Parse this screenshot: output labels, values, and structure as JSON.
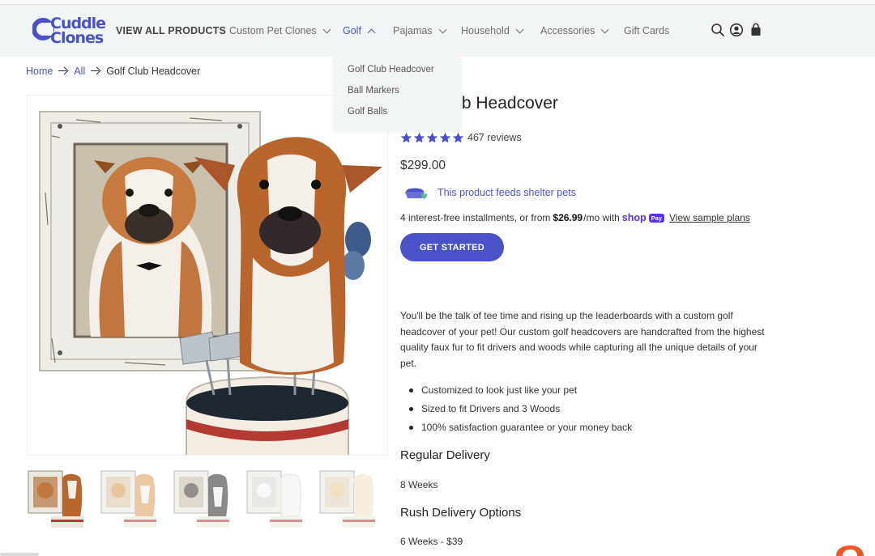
{
  "brand": {
    "logo_line1": "Cuddle",
    "logo_line2": "Clones",
    "accent": "#4b52c7"
  },
  "nav": {
    "items": [
      {
        "label": "VIEW ALL PRODUCTS",
        "dropdown": false
      },
      {
        "label": "Custom Pet Clones",
        "dropdown": true
      },
      {
        "label": "Golf",
        "dropdown": true,
        "expanded": true
      },
      {
        "label": "Pajamas",
        "dropdown": true
      },
      {
        "label": "Household",
        "dropdown": true
      },
      {
        "label": "Accessories",
        "dropdown": true
      },
      {
        "label": "Gift Cards",
        "dropdown": false
      }
    ],
    "icons": [
      "search-icon",
      "account-icon",
      "cart-bag-icon"
    ]
  },
  "golf_menu": {
    "items": [
      "Golf Club Headcover",
      "Ball Markers",
      "Golf Balls"
    ]
  },
  "breadcrumb": {
    "home": "Home",
    "all": "All",
    "current": "Golf Club Headcover"
  },
  "product": {
    "title": "Golf Club Headcover",
    "rating": 5,
    "reviews": "467 reviews",
    "price": "$299.00",
    "shelter_text": "This product feeds shelter pets",
    "installments": {
      "prefix": "4 interest-free installments, or from",
      "amount": "$26.99",
      "suffix": "/mo with",
      "shop": "shop",
      "pay": "Pay",
      "link": "View sample plans"
    },
    "cta": "GET STARTED",
    "description": "You'll be the talk of tee time and rising up the leaderboards with a custom golf headcover of your pet! Our custom golf headcovers are handcrafted from the highest quality faux fur to fit drivers and woods while capturing all the unique details of your pet.",
    "bullets": [
      "Customized to look just like your pet",
      "Sized to fit Drivers and 3 Woods",
      "100% satisfaction guarantee or your money back"
    ],
    "regular_delivery": {
      "heading": "Regular Delivery",
      "value": "8 Weeks"
    },
    "rush_delivery": {
      "heading": "Rush Delivery Options",
      "value": "6 Weeks - $39"
    }
  },
  "gallery": {
    "thumbnails": [
      "bulldog-headcover",
      "corgi-headcover",
      "spaniel-headcover",
      "white-dog-headcover",
      "golden-dog-headcover"
    ]
  }
}
